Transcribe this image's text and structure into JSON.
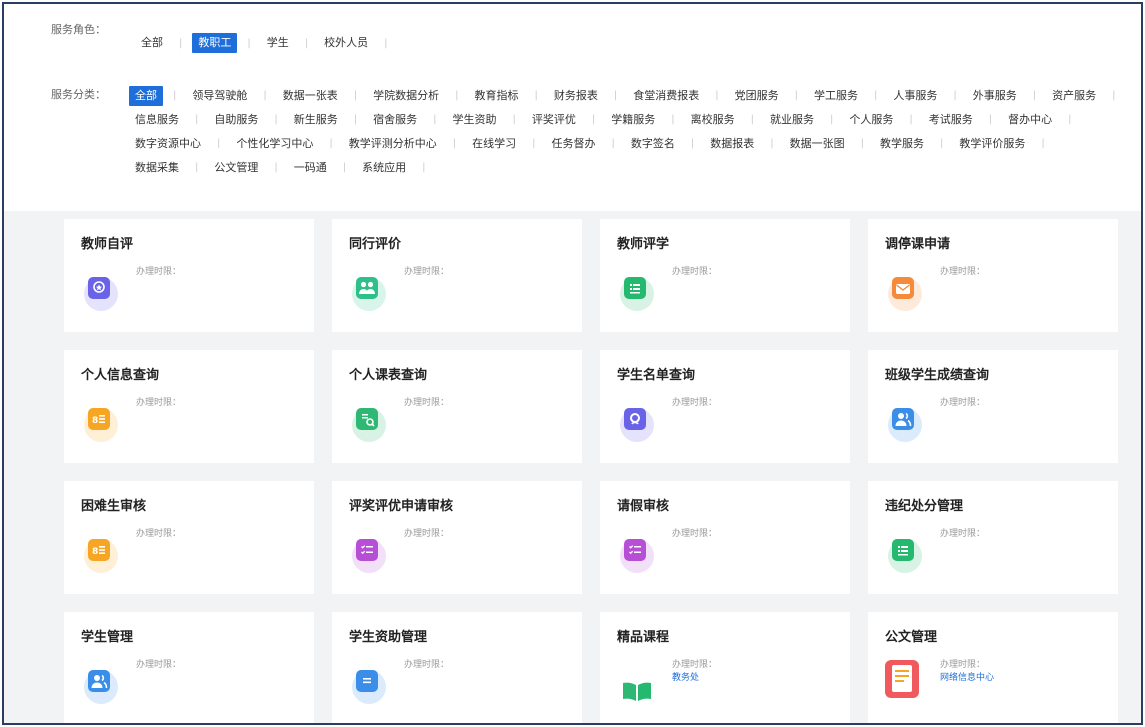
{
  "filters": {
    "role_label": "服务角色：",
    "roles": [
      "全部",
      "教职工",
      "学生",
      "校外人员"
    ],
    "active_role": "教职工",
    "category_label": "服务分类：",
    "categories": [
      "全部",
      "领导驾驶舱",
      "数据一张表",
      "学院数据分析",
      "教育指标",
      "财务报表",
      "食堂消费报表",
      "党团服务",
      "学工服务",
      "人事服务",
      "外事服务",
      "资产服务",
      "信息服务",
      "自助服务",
      "新生服务",
      "宿舍服务",
      "学生资助",
      "评奖评优",
      "学籍服务",
      "离校服务",
      "就业服务",
      "个人服务",
      "考试服务",
      "督办中心",
      "数字资源中心",
      "个性化学习中心",
      "教学评测分析中心",
      "在线学习",
      "任务督办",
      "数字签名",
      "数据报表",
      "数据一张图",
      "教学服务",
      "教学评价服务",
      "数据采集",
      "公文管理",
      "一码通",
      "系统应用"
    ],
    "active_category": "全部"
  },
  "cards": [
    {
      "title": "教师自评",
      "meta": "办理时限：",
      "dept": "",
      "icon": "award-icon",
      "color": "#6a63e8"
    },
    {
      "title": "同行评价",
      "meta": "办理时限：",
      "dept": "",
      "icon": "people-icon",
      "color": "#2fc08a"
    },
    {
      "title": "教师评学",
      "meta": "办理时限：",
      "dept": "",
      "icon": "list-icon",
      "color": "#25b86f"
    },
    {
      "title": "调停课申请",
      "meta": "办理时限：",
      "dept": "",
      "icon": "envelope-icon",
      "color": "#f58a3a"
    },
    {
      "title": "个人信息查询",
      "meta": "办理时限：",
      "dept": "",
      "icon": "id-card-icon",
      "color": "#f7a623"
    },
    {
      "title": "个人课表查询",
      "meta": "办理时限：",
      "dept": "",
      "icon": "doc-search-icon",
      "color": "#2fb873"
    },
    {
      "title": "学生名单查询",
      "meta": "办理时限：",
      "dept": "",
      "icon": "search-icon",
      "color": "#6a63e8"
    },
    {
      "title": "班级学生成绩查询",
      "meta": "办理时限：",
      "dept": "",
      "icon": "users-icon",
      "color": "#3a8ee8"
    },
    {
      "title": "困难生审核",
      "meta": "办理时限：",
      "dept": "",
      "icon": "id-card-icon",
      "color": "#f7a623"
    },
    {
      "title": "评奖评优申请审核",
      "meta": "办理时限：",
      "dept": "",
      "icon": "checklist-icon",
      "color": "#b74ed6"
    },
    {
      "title": "请假审核",
      "meta": "办理时限：",
      "dept": "",
      "icon": "checklist-icon",
      "color": "#b74ed6"
    },
    {
      "title": "违纪处分管理",
      "meta": "办理时限：",
      "dept": "",
      "icon": "list-icon",
      "color": "#25b86f"
    },
    {
      "title": "学生管理",
      "meta": "办理时限：",
      "dept": "",
      "icon": "users-icon",
      "color": "#3a8ee8"
    },
    {
      "title": "学生资助管理",
      "meta": "办理时限：",
      "dept": "",
      "icon": "bookmark-icon",
      "color": "#3a8ee8"
    },
    {
      "title": "精品课程",
      "meta": "办理时限：",
      "dept": "教务处",
      "icon": "book-icon",
      "color": "#25b86f"
    },
    {
      "title": "公文管理",
      "meta": "办理时限：",
      "dept": "网络信息中心",
      "icon": "document-icon",
      "color": "#f0595e"
    }
  ]
}
